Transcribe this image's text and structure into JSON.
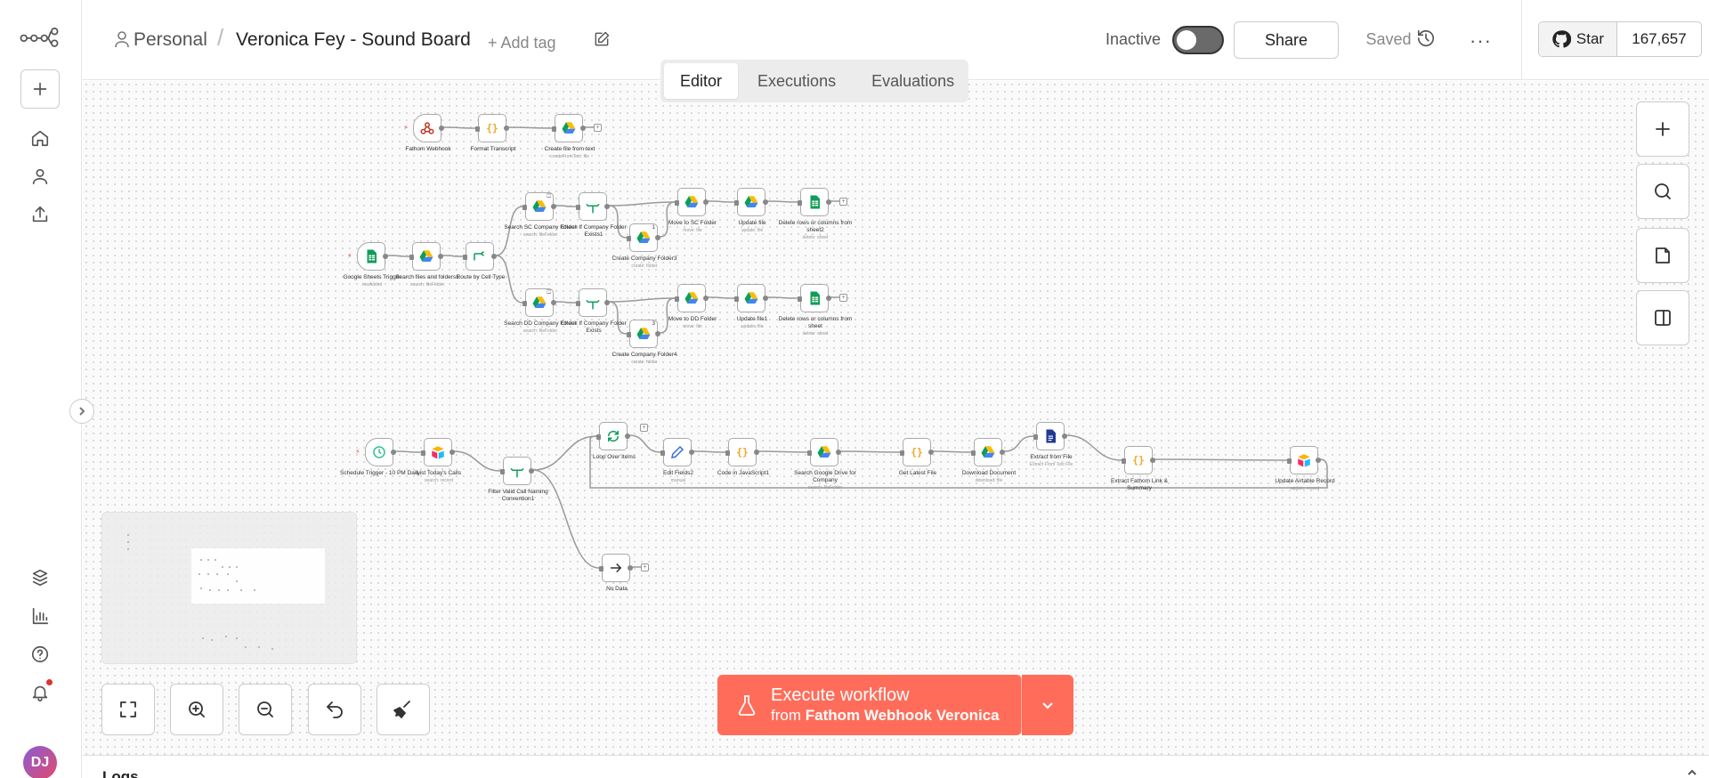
{
  "header": {
    "project": "Personal",
    "separator": "/",
    "workflow_name": "Veronica Fey - Sound Board",
    "add_tag": "+ Add tag",
    "tabs": [
      {
        "label": "Editor",
        "active": true
      },
      {
        "label": "Executions",
        "active": false
      },
      {
        "label": "Evaluations",
        "active": false
      }
    ],
    "status_label": "Inactive",
    "active": false,
    "share_label": "Share",
    "saved_label": "Saved",
    "more_label": "···",
    "github_star_label": "Star",
    "github_star_count": "167,657"
  },
  "sidebar": {
    "avatar_initials": "DJ",
    "notification": true
  },
  "nodes": [
    {
      "id": "n1",
      "label": "Fathom Webhook",
      "sub": "",
      "icon": "webhook-icon",
      "trigger": true
    },
    {
      "id": "n2",
      "label": "Format Transcript",
      "sub": "",
      "icon": "code-icon"
    },
    {
      "id": "n3",
      "label": "Create file from text",
      "sub": "createFromText: file",
      "icon": "google-drive-icon"
    },
    {
      "id": "n4",
      "label": "Google Sheets Trigger",
      "sub": "rowAdded",
      "icon": "google-sheets-icon",
      "trigger": true
    },
    {
      "id": "n5",
      "label": "Search files and folders1",
      "sub": "search: fileFolder",
      "icon": "google-drive-icon"
    },
    {
      "id": "n6",
      "label": "Route by Cell Type",
      "sub": "",
      "icon": "switch-icon"
    },
    {
      "id": "n7",
      "label": "Search SC Company Folder",
      "sub": "search: fileFolder",
      "icon": "google-drive-icon",
      "badge": "⏍"
    },
    {
      "id": "n8",
      "label": "Check If Company Folder Exists1",
      "sub": "",
      "icon": "if-icon"
    },
    {
      "id": "n9",
      "label": "Create Company Folder3",
      "sub": "create: folder",
      "icon": "google-drive-icon",
      "badge": "1"
    },
    {
      "id": "n10",
      "label": "Move to SC Folder",
      "sub": "move: file",
      "icon": "google-drive-icon"
    },
    {
      "id": "n11",
      "label": "Update file",
      "sub": "update: file",
      "icon": "google-drive-icon"
    },
    {
      "id": "n12",
      "label": "Delete rows or columns from sheet2",
      "sub": "delete: sheet",
      "icon": "google-sheets-icon"
    },
    {
      "id": "n13",
      "label": "Search DD Company Folder",
      "sub": "search: fileFolder",
      "icon": "google-drive-icon",
      "badge": "⏍"
    },
    {
      "id": "n14",
      "label": "Check If Company Folder Exists",
      "sub": "",
      "icon": "if-icon"
    },
    {
      "id": "n15",
      "label": "Create Company Folder4",
      "sub": "create: folder",
      "icon": "google-drive-icon",
      "badge": "3"
    },
    {
      "id": "n16",
      "label": "Move to DD Folder",
      "sub": "move: file",
      "icon": "google-drive-icon"
    },
    {
      "id": "n17",
      "label": "Update file1",
      "sub": "update: file",
      "icon": "google-drive-icon"
    },
    {
      "id": "n18",
      "label": "Delete rows or columns from sheet",
      "sub": "delete: sheet",
      "icon": "google-sheets-icon"
    },
    {
      "id": "n19",
      "label": "Schedule Trigger - 10 PM Daily",
      "sub": "",
      "icon": "clock-icon",
      "trigger": true
    },
    {
      "id": "n20",
      "label": "List Today's Calls",
      "sub": "search: record",
      "icon": "airtable-icon"
    },
    {
      "id": "n21",
      "label": "Filter Valid Call Naming Convention1",
      "sub": "",
      "icon": "if-icon"
    },
    {
      "id": "n22",
      "label": "Loop Over Items",
      "sub": "",
      "icon": "loop-icon"
    },
    {
      "id": "n23",
      "label": "Edit Fields2",
      "sub": "manual",
      "icon": "pencil-icon"
    },
    {
      "id": "n24",
      "label": "Code in JavaScript1",
      "sub": "",
      "icon": "code-icon"
    },
    {
      "id": "n25",
      "label": "Search Google Drive for Company",
      "sub": "search: fileFolder",
      "icon": "google-drive-icon"
    },
    {
      "id": "n26",
      "label": "Get Latest File",
      "sub": "",
      "icon": "code-icon"
    },
    {
      "id": "n27",
      "label": "Download Document",
      "sub": "download: file",
      "icon": "google-drive-icon"
    },
    {
      "id": "n28",
      "label": "Extract from File",
      "sub": "Extract From Text File",
      "icon": "extract-file-icon"
    },
    {
      "id": "n29",
      "label": "Extract Fathom Link & Summary",
      "sub": "",
      "icon": "code-icon"
    },
    {
      "id": "n30",
      "label": "Update Airtable Record",
      "sub": "update: record",
      "icon": "airtable-icon"
    },
    {
      "id": "n31",
      "label": "No Data",
      "sub": "",
      "icon": "arrow-right-icon"
    }
  ],
  "execute": {
    "title": "Execute workflow",
    "from_prefix": "from",
    "from_node": "Fathom Webhook Veronica"
  },
  "logs": {
    "label": "Logs"
  }
}
